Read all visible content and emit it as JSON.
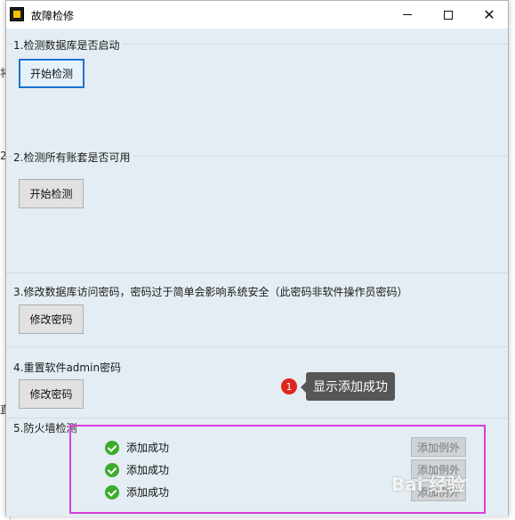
{
  "background_fragments": [
    "将",
    "2.",
    "直",
    "译"
  ],
  "window": {
    "title": "故障检修",
    "controls": {
      "minimize": "minimize",
      "maximize": "maximize",
      "close": "✕"
    }
  },
  "sections": [
    {
      "title": "1.检测数据库是否启动",
      "button": "开始检测"
    },
    {
      "title": "2.检测所有账套是否可用",
      "button": "开始检测"
    },
    {
      "title": "3.修改数据库访问密码，密码过于简单会影响系统安全（此密码非软件操作员密码）",
      "button": "修改密码"
    },
    {
      "title": "4.重置软件admin密码",
      "button": "修改密码"
    },
    {
      "title": "5.防火墙检测"
    }
  ],
  "firewall": {
    "rows": [
      {
        "status": "添加成功",
        "button": "添加例外"
      },
      {
        "status": "添加成功",
        "button": "添加例外"
      },
      {
        "status": "添加成功",
        "button": "添加例外"
      }
    ]
  },
  "annotation": {
    "number": "1",
    "text": "显示添加成功"
  },
  "watermark": "Bai 经验",
  "colors": {
    "content_bg": "#e3edf3",
    "highlight": "#d93dd9",
    "success": "#3cab2c",
    "annotation_bg": "#565656",
    "badge": "#e0251f"
  }
}
